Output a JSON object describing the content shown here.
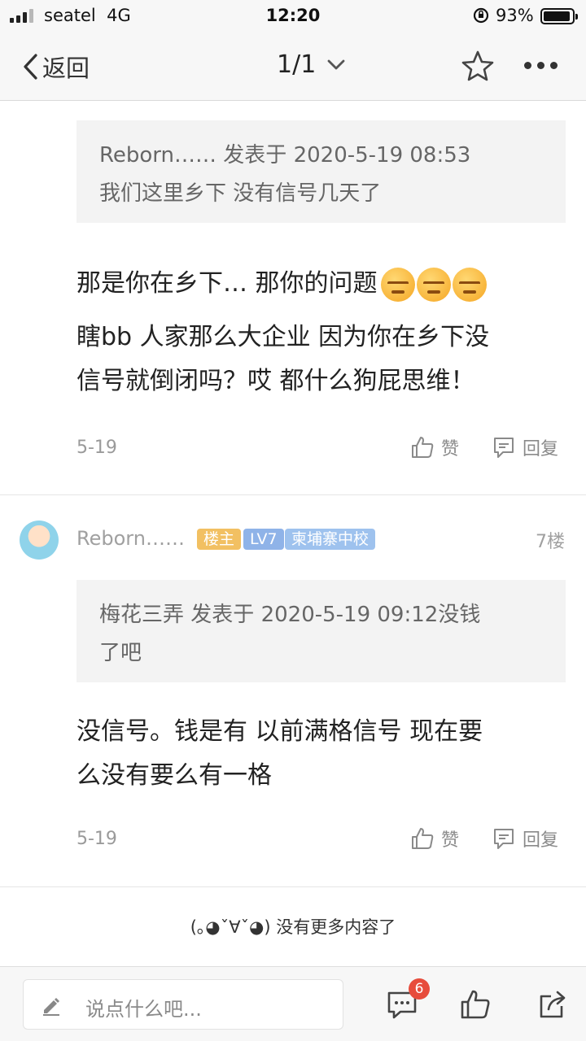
{
  "status_bar": {
    "carrier": "seatel",
    "network": "4G",
    "time": "12:20",
    "battery_percent": "93%",
    "battery_level": 0.93
  },
  "nav": {
    "back_label": "返回",
    "page_indicator": "1/1",
    "icons": [
      "chevron-left-icon",
      "chevron-down-icon",
      "star-icon",
      "more-icon"
    ]
  },
  "posts": [
    {
      "quote": {
        "author": "Reborn……",
        "posted_label": "发表于",
        "datetime": "2020-5-19 08:53",
        "text": "我们这里乡下 没有信号几天了"
      },
      "body_line1": "那是你在乡下… 那你的问题",
      "body_line2": "瞎bb 人家那么大企业 因为你在乡下没",
      "body_line3": "信号就倒闭吗？哎 都什么狗屁思维！",
      "emoji_count": 3,
      "date": "5-19",
      "like_label": "赞",
      "reply_label": "回复"
    },
    {
      "author": "Reborn……",
      "badges": {
        "owner": "楼主",
        "level": "LV7",
        "school": "柬埔寨中校"
      },
      "floor": "7楼",
      "quote": {
        "author": "梅花三弄",
        "posted_label": "发表于",
        "datetime": "2020-5-19 09:12",
        "text_line1_tail": "没钱",
        "text_line2": "了吧"
      },
      "body_line1": "没信号。钱是有 以前满格信号 现在要",
      "body_line2": "么没有要么有一格",
      "date": "5-19",
      "like_label": "赞",
      "reply_label": "回复"
    }
  ],
  "end_note": "(｡◕ˇ∀ˇ◕) 没有更多内容了",
  "bottom_bar": {
    "comment_placeholder": "说点什么吧...",
    "comment_badge": "6"
  }
}
